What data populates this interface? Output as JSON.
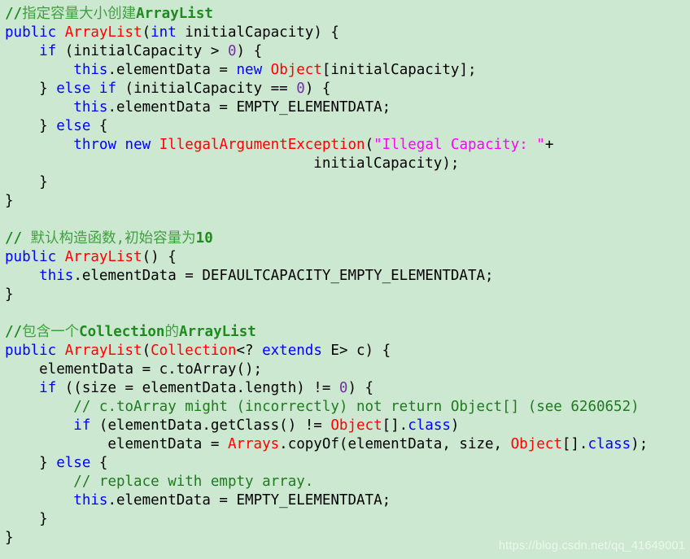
{
  "document": {
    "kind": "code-snippet",
    "language": "java",
    "background_color": "#cde8d1",
    "default_text_color": "#000000"
  },
  "palette": {
    "keyword": "#0000ff",
    "type": "#ff0000",
    "string": "#ff00ff",
    "number": "#7030a0",
    "comment": "#3f9f3f",
    "comment_emphasis": "#1f8a1f",
    "plain": "#000000",
    "watermark": "#ecf7ee"
  },
  "watermark": {
    "text": "https://blog.csdn.net/qq_41649001"
  },
  "code": {
    "lines": [
      {
        "number": 1,
        "text": "//指定容量大小创建ArrayList",
        "tokens": [
          {
            "t": "//",
            "c": "comment-bold"
          },
          {
            "t": "指定容量大小创建",
            "c": "comment"
          },
          {
            "t": "ArrayList",
            "c": "comment-bold"
          }
        ]
      },
      {
        "number": 2,
        "text": "public ArrayList(int initialCapacity) {",
        "tokens": [
          {
            "t": "public",
            "c": "keyword"
          },
          {
            "t": " ",
            "c": "plain"
          },
          {
            "t": "ArrayList",
            "c": "type"
          },
          {
            "t": "(",
            "c": "plain"
          },
          {
            "t": "int",
            "c": "keyword"
          },
          {
            "t": " initialCapacity) {",
            "c": "plain"
          }
        ]
      },
      {
        "number": 3,
        "text": "    if (initialCapacity > 0) {",
        "tokens": [
          {
            "t": "    ",
            "c": "plain"
          },
          {
            "t": "if",
            "c": "keyword"
          },
          {
            "t": " (initialCapacity > ",
            "c": "plain"
          },
          {
            "t": "0",
            "c": "number"
          },
          {
            "t": ") {",
            "c": "plain"
          }
        ]
      },
      {
        "number": 4,
        "text": "        this.elementData = new Object[initialCapacity];",
        "tokens": [
          {
            "t": "        ",
            "c": "plain"
          },
          {
            "t": "this",
            "c": "keyword"
          },
          {
            "t": ".elementData = ",
            "c": "plain"
          },
          {
            "t": "new",
            "c": "keyword"
          },
          {
            "t": " ",
            "c": "plain"
          },
          {
            "t": "Object",
            "c": "type"
          },
          {
            "t": "[initialCapacity];",
            "c": "plain"
          }
        ]
      },
      {
        "number": 5,
        "text": "    } else if (initialCapacity == 0) {",
        "tokens": [
          {
            "t": "    } ",
            "c": "plain"
          },
          {
            "t": "else",
            "c": "keyword"
          },
          {
            "t": " ",
            "c": "plain"
          },
          {
            "t": "if",
            "c": "keyword"
          },
          {
            "t": " (initialCapacity == ",
            "c": "plain"
          },
          {
            "t": "0",
            "c": "number"
          },
          {
            "t": ") {",
            "c": "plain"
          }
        ]
      },
      {
        "number": 6,
        "text": "        this.elementData = EMPTY_ELEMENTDATA;",
        "tokens": [
          {
            "t": "        ",
            "c": "plain"
          },
          {
            "t": "this",
            "c": "keyword"
          },
          {
            "t": ".elementData = EMPTY_ELEMENTDATA;",
            "c": "plain"
          }
        ]
      },
      {
        "number": 7,
        "text": "    } else {",
        "tokens": [
          {
            "t": "    } ",
            "c": "plain"
          },
          {
            "t": "else",
            "c": "keyword"
          },
          {
            "t": " {",
            "c": "plain"
          }
        ]
      },
      {
        "number": 8,
        "text": "        throw new IllegalArgumentException(\"Illegal Capacity: \"+",
        "tokens": [
          {
            "t": "        ",
            "c": "plain"
          },
          {
            "t": "throw",
            "c": "keyword"
          },
          {
            "t": " ",
            "c": "plain"
          },
          {
            "t": "new",
            "c": "keyword"
          },
          {
            "t": " ",
            "c": "plain"
          },
          {
            "t": "IllegalArgumentException",
            "c": "type"
          },
          {
            "t": "(",
            "c": "plain"
          },
          {
            "t": "\"Illegal Capacity: \"",
            "c": "string"
          },
          {
            "t": "+",
            "c": "plain"
          }
        ]
      },
      {
        "number": 9,
        "text": "                                    initialCapacity);",
        "tokens": [
          {
            "t": "                                    initialCapacity);",
            "c": "plain"
          }
        ]
      },
      {
        "number": 10,
        "text": "    }",
        "tokens": [
          {
            "t": "    }",
            "c": "plain"
          }
        ]
      },
      {
        "number": 11,
        "text": "}",
        "tokens": [
          {
            "t": "}",
            "c": "plain"
          }
        ]
      },
      {
        "number": 12,
        "text": "",
        "tokens": []
      },
      {
        "number": 13,
        "text": "// 默认构造函数,初始容量为10",
        "tokens": [
          {
            "t": "// ",
            "c": "comment-bold"
          },
          {
            "t": "默认构造函数,初始容量为",
            "c": "comment"
          },
          {
            "t": "10",
            "c": "comment-bold"
          }
        ]
      },
      {
        "number": 14,
        "text": "public ArrayList() {",
        "tokens": [
          {
            "t": "public",
            "c": "keyword"
          },
          {
            "t": " ",
            "c": "plain"
          },
          {
            "t": "ArrayList",
            "c": "type"
          },
          {
            "t": "() {",
            "c": "plain"
          }
        ]
      },
      {
        "number": 15,
        "text": "    this.elementData = DEFAULTCAPACITY_EMPTY_ELEMENTDATA;",
        "tokens": [
          {
            "t": "    ",
            "c": "plain"
          },
          {
            "t": "this",
            "c": "keyword"
          },
          {
            "t": ".elementData = DEFAULTCAPACITY_EMPTY_ELEMENTDATA;",
            "c": "plain"
          }
        ]
      },
      {
        "number": 16,
        "text": "}",
        "tokens": [
          {
            "t": "}",
            "c": "plain"
          }
        ]
      },
      {
        "number": 17,
        "text": "",
        "tokens": []
      },
      {
        "number": 18,
        "text": "//包含一个Collection的ArrayList",
        "tokens": [
          {
            "t": "//",
            "c": "comment-bold"
          },
          {
            "t": "包含一个",
            "c": "comment"
          },
          {
            "t": "Collection",
            "c": "comment-bold"
          },
          {
            "t": "的",
            "c": "comment"
          },
          {
            "t": "ArrayList",
            "c": "comment-bold"
          }
        ]
      },
      {
        "number": 19,
        "text": "public ArrayList(Collection<? extends E> c) {",
        "tokens": [
          {
            "t": "public",
            "c": "keyword"
          },
          {
            "t": " ",
            "c": "plain"
          },
          {
            "t": "ArrayList",
            "c": "type"
          },
          {
            "t": "(",
            "c": "plain"
          },
          {
            "t": "Collection",
            "c": "type"
          },
          {
            "t": "<? ",
            "c": "plain"
          },
          {
            "t": "extends",
            "c": "keyword"
          },
          {
            "t": " E> c) {",
            "c": "plain"
          }
        ]
      },
      {
        "number": 20,
        "text": "    elementData = c.toArray();",
        "tokens": [
          {
            "t": "    elementData = c.toArray();",
            "c": "plain"
          }
        ]
      },
      {
        "number": 21,
        "text": "    if ((size = elementData.length) != 0) {",
        "tokens": [
          {
            "t": "    ",
            "c": "plain"
          },
          {
            "t": "if",
            "c": "keyword"
          },
          {
            "t": " ((size = elementData.length) != ",
            "c": "plain"
          },
          {
            "t": "0",
            "c": "number"
          },
          {
            "t": ") {",
            "c": "plain"
          }
        ]
      },
      {
        "number": 22,
        "text": "        // c.toArray might (incorrectly) not return Object[] (see 6260652)",
        "tokens": [
          {
            "t": "        ",
            "c": "plain"
          },
          {
            "t": "// c.toArray might (incorrectly) not return Object[] (see 6260652)",
            "c": "comment-dark"
          }
        ]
      },
      {
        "number": 23,
        "text": "        if (elementData.getClass() != Object[].class)",
        "tokens": [
          {
            "t": "        ",
            "c": "plain"
          },
          {
            "t": "if",
            "c": "keyword"
          },
          {
            "t": " (elementData.getClass() != ",
            "c": "plain"
          },
          {
            "t": "Object",
            "c": "type"
          },
          {
            "t": "[].",
            "c": "plain"
          },
          {
            "t": "class",
            "c": "member"
          },
          {
            "t": ")",
            "c": "plain"
          }
        ]
      },
      {
        "number": 24,
        "text": "            elementData = Arrays.copyOf(elementData, size, Object[].class);",
        "tokens": [
          {
            "t": "            elementData = ",
            "c": "plain"
          },
          {
            "t": "Arrays",
            "c": "type"
          },
          {
            "t": ".copyOf(elementData, size, ",
            "c": "plain"
          },
          {
            "t": "Object",
            "c": "type"
          },
          {
            "t": "[].",
            "c": "plain"
          },
          {
            "t": "class",
            "c": "member"
          },
          {
            "t": ");",
            "c": "plain"
          }
        ]
      },
      {
        "number": 25,
        "text": "    } else {",
        "tokens": [
          {
            "t": "    } ",
            "c": "plain"
          },
          {
            "t": "else",
            "c": "keyword"
          },
          {
            "t": " {",
            "c": "plain"
          }
        ]
      },
      {
        "number": 26,
        "text": "        // replace with empty array.",
        "tokens": [
          {
            "t": "        ",
            "c": "plain"
          },
          {
            "t": "// replace with empty array.",
            "c": "comment-dark"
          }
        ]
      },
      {
        "number": 27,
        "text": "        this.elementData = EMPTY_ELEMENTDATA;",
        "tokens": [
          {
            "t": "        ",
            "c": "plain"
          },
          {
            "t": "this",
            "c": "keyword"
          },
          {
            "t": ".elementData = EMPTY_ELEMENTDATA;",
            "c": "plain"
          }
        ]
      },
      {
        "number": 28,
        "text": "    }",
        "tokens": [
          {
            "t": "    }",
            "c": "plain"
          }
        ]
      },
      {
        "number": 29,
        "text": "}",
        "tokens": [
          {
            "t": "}",
            "c": "plain"
          }
        ]
      }
    ]
  }
}
